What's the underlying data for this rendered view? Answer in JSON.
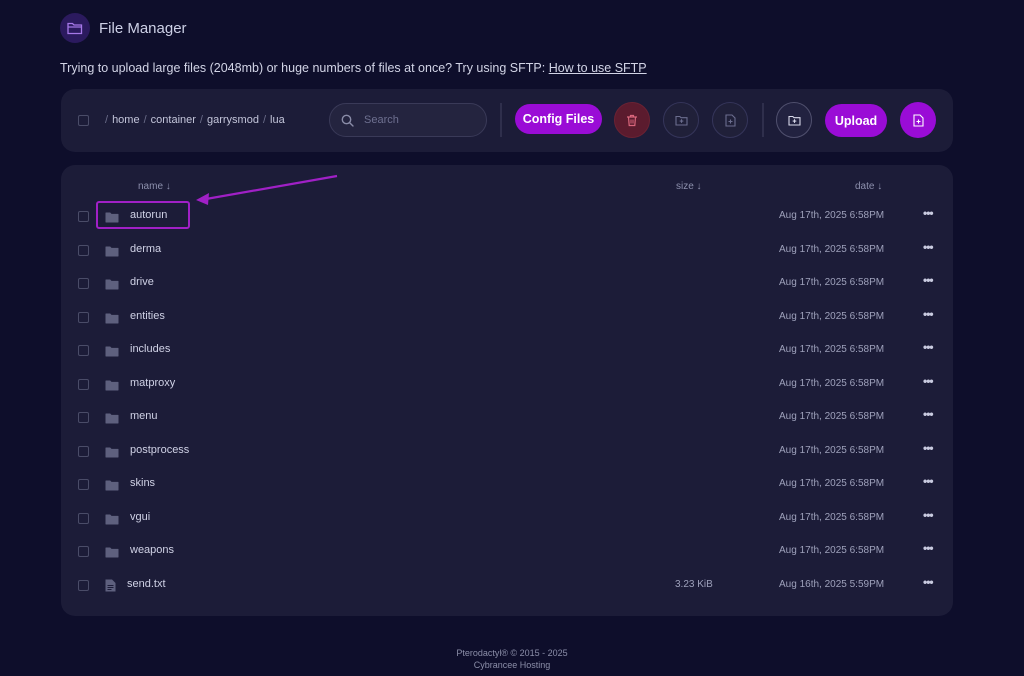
{
  "app": {
    "title": "File Manager"
  },
  "notice": {
    "text": "Trying to upload large files (2048mb) or huge numbers of files at once? Try using SFTP:",
    "link": "How to use SFTP"
  },
  "toolbar": {
    "breadcrumb": [
      "home",
      "container",
      "garrysmod",
      "lua"
    ],
    "search_placeholder": "Search",
    "config_button": "Config Files",
    "upload_button": "Upload"
  },
  "table": {
    "headers": {
      "name": "name ↓",
      "size": "size ↓",
      "date": "date ↓"
    },
    "rows": [
      {
        "type": "folder",
        "name": "autorun",
        "size": "",
        "date": "Aug 17th, 2025 6:58PM"
      },
      {
        "type": "folder",
        "name": "derma",
        "size": "",
        "date": "Aug 17th, 2025 6:58PM"
      },
      {
        "type": "folder",
        "name": "drive",
        "size": "",
        "date": "Aug 17th, 2025 6:58PM"
      },
      {
        "type": "folder",
        "name": "entities",
        "size": "",
        "date": "Aug 17th, 2025 6:58PM"
      },
      {
        "type": "folder",
        "name": "includes",
        "size": "",
        "date": "Aug 17th, 2025 6:58PM"
      },
      {
        "type": "folder",
        "name": "matproxy",
        "size": "",
        "date": "Aug 17th, 2025 6:58PM"
      },
      {
        "type": "folder",
        "name": "menu",
        "size": "",
        "date": "Aug 17th, 2025 6:58PM"
      },
      {
        "type": "folder",
        "name": "postprocess",
        "size": "",
        "date": "Aug 17th, 2025 6:58PM"
      },
      {
        "type": "folder",
        "name": "skins",
        "size": "",
        "date": "Aug 17th, 2025 6:58PM"
      },
      {
        "type": "folder",
        "name": "vgui",
        "size": "",
        "date": "Aug 17th, 2025 6:58PM"
      },
      {
        "type": "folder",
        "name": "weapons",
        "size": "",
        "date": "Aug 17th, 2025 6:58PM"
      },
      {
        "type": "file",
        "name": "send.txt",
        "size": "3.23 KiB",
        "date": "Aug 16th, 2025 5:59PM"
      }
    ],
    "row_menu": "•••"
  },
  "footer": {
    "line1": "Pterodactyl® © 2015 - 2025",
    "line2": "Cybrancee Hosting"
  },
  "colors": {
    "accent": "#9a0cd6",
    "background": "#0e0e2b",
    "panel": "#1c1c38",
    "danger": "#5b1b2e",
    "annotation": "#a020c6"
  },
  "icons": [
    "folder-open-icon",
    "search-icon",
    "trash-icon",
    "folder-plus-icon",
    "file-plus-icon",
    "folder-icon",
    "file-icon",
    "more-icon"
  ]
}
